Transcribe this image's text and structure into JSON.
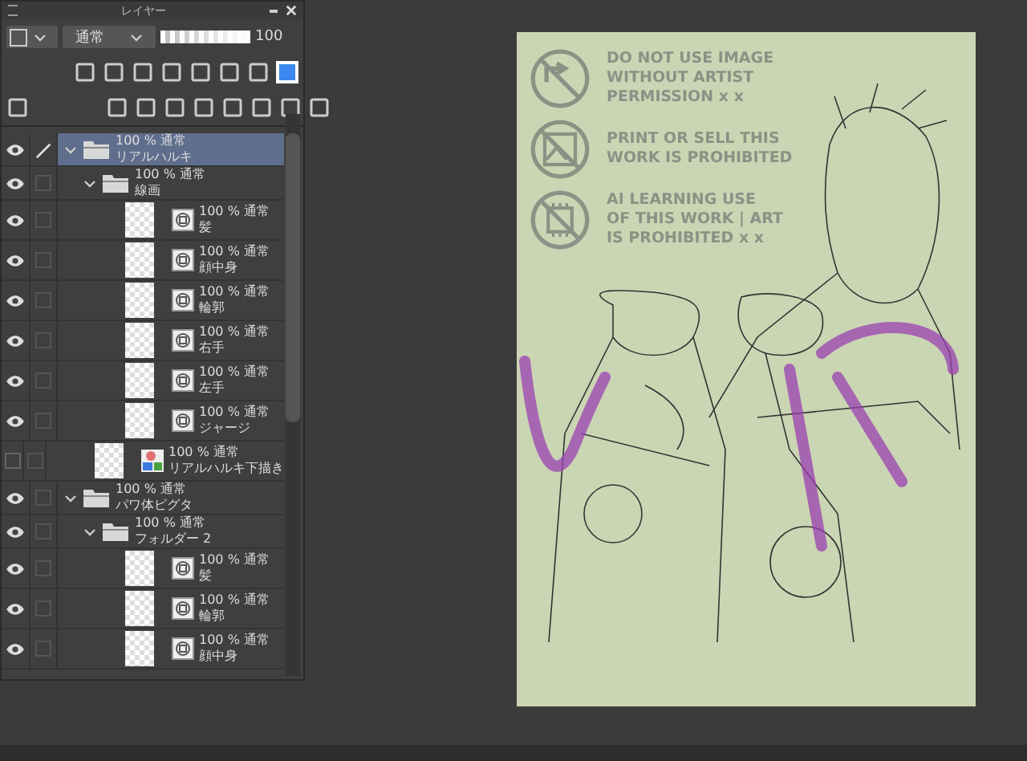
{
  "layer_panel": {
    "title": "レイヤー",
    "blend_mode": "通常",
    "opacity": {
      "level": 1.0,
      "reading": "100"
    },
    "layers": [
      {
        "kind": "folder",
        "mode": "100 % 通常",
        "name": "リアルハルキ",
        "visible": true,
        "selected": true,
        "editing": true,
        "expanded": true,
        "children": [
          {
            "kind": "folder",
            "mode": "100 % 通常",
            "name": "線画",
            "visible": true,
            "selected": false,
            "editing": false,
            "expanded": true,
            "children": [
              {
                "kind": "vector",
                "mode": "100 % 通常",
                "name": "髪",
                "visible": true,
                "selected": false,
                "editing": false
              },
              {
                "kind": "vector",
                "mode": "100 % 通常",
                "name": "顔中身",
                "visible": true,
                "selected": false,
                "editing": false
              },
              {
                "kind": "vector",
                "mode": "100 % 通常",
                "name": "輪郭",
                "visible": true,
                "selected": false,
                "editing": false
              },
              {
                "kind": "vector",
                "mode": "100 % 通常",
                "name": "右手",
                "visible": true,
                "selected": false,
                "editing": false
              },
              {
                "kind": "vector",
                "mode": "100 % 通常",
                "name": "左手",
                "visible": true,
                "selected": false,
                "editing": false
              },
              {
                "kind": "vector",
                "mode": "100 % 通常",
                "name": "ジャージ",
                "visible": true,
                "selected": false,
                "editing": false
              }
            ]
          },
          {
            "kind": "raster",
            "mode": "100 % 通常",
            "name": "リアルハルキ下描き",
            "visible": false,
            "selected": false,
            "editing": false
          }
        ]
      },
      {
        "kind": "folder",
        "mode": "100 % 通常",
        "name": "パワ体ピグタ",
        "visible": true,
        "selected": false,
        "editing": false,
        "expanded": true,
        "children": [
          {
            "kind": "folder",
            "mode": "100 % 通常",
            "name": "フォルダー 2",
            "visible": true,
            "selected": false,
            "editing": false,
            "expanded": true,
            "children": [
              {
                "kind": "vector",
                "mode": "100 % 通常",
                "name": "髪",
                "visible": true,
                "selected": false,
                "editing": false
              },
              {
                "kind": "vector",
                "mode": "100 % 通常",
                "name": "輪郭",
                "visible": true,
                "selected": false,
                "editing": false
              },
              {
                "kind": "vector",
                "mode": "100 % 通常",
                "name": "顔中身",
                "visible": true,
                "selected": false,
                "editing": false
              }
            ]
          }
        ]
      }
    ]
  },
  "canvas": {
    "notices": [
      {
        "kind": "no-share",
        "text": "DO NOT USE IMAGE\nWITHOUT ARTIST\nPERMISSION x x"
      },
      {
        "kind": "no-print",
        "text": "PRINT OR SELL THIS\nWORK IS PROHIBITED"
      },
      {
        "kind": "no-ai",
        "text": "AI LEARNING USE\nOF THIS WORK | ART\nIS PROHIBITED x x"
      }
    ]
  }
}
